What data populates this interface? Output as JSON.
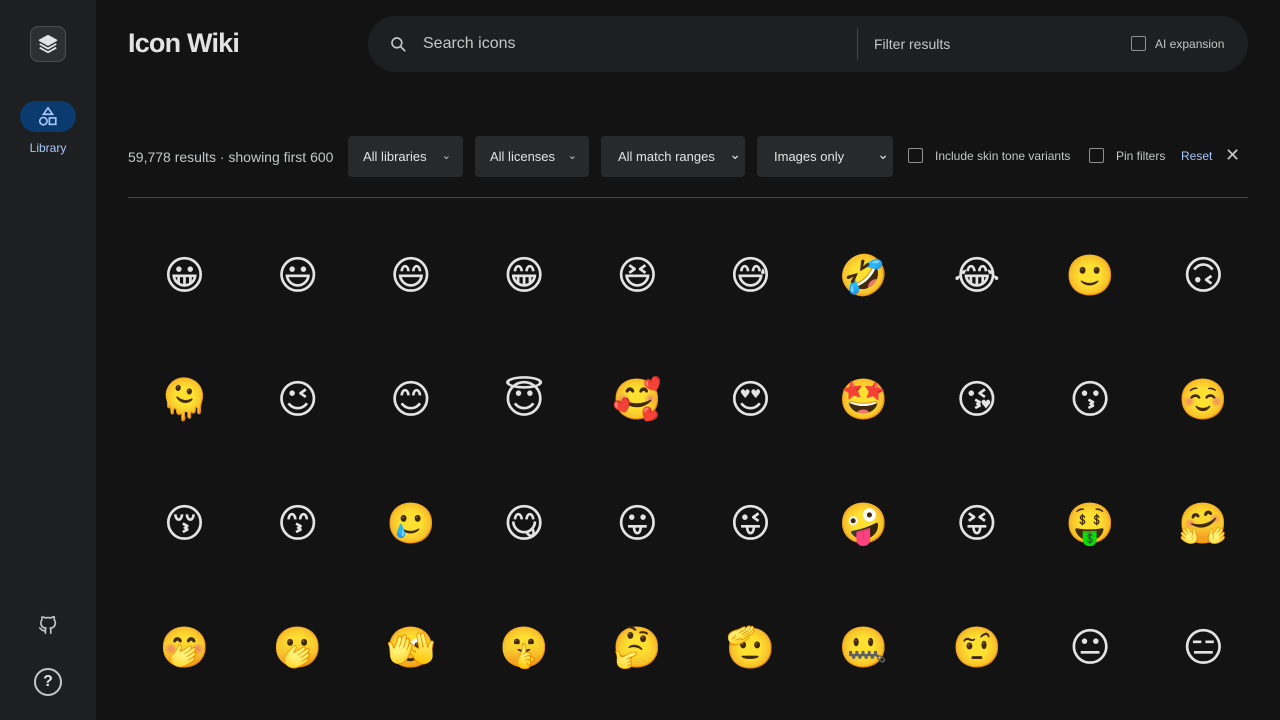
{
  "app": {
    "title": "Icon Wiki"
  },
  "rail": {
    "logo_icon": "layers-icon",
    "nav_items": [
      {
        "label": "Library",
        "icon": "shapes-icon",
        "active": true
      }
    ],
    "footer_icons": [
      "github-icon",
      "help-icon"
    ],
    "help_glyph": "?"
  },
  "search": {
    "placeholder": "Search icons",
    "value": "",
    "filter_placeholder": "Filter results",
    "filter_value": "",
    "ai_expansion_label": "AI expansion",
    "ai_expansion_checked": false
  },
  "filters": {
    "results_text": "59,778 results · showing first 600",
    "libraries": "All libraries",
    "licenses": "All licenses",
    "match_ranges": "All match ranges",
    "media": "Images only",
    "skin_tone_label": "Include skin tone variants",
    "skin_tone_checked": false,
    "pin_filters_label": "Pin filters",
    "pin_filters_checked": false,
    "reset_label": "Reset",
    "close_glyph": "✕"
  },
  "colors": {
    "background": "#131314",
    "rail": "#1e1f20",
    "accent": "#a8c7fa",
    "active_pill": "#0b3a6e"
  },
  "icons": [
    [
      "😀",
      "😃",
      "😄",
      "😁",
      "😆",
      "😅",
      "🤣",
      "😂",
      "🙂",
      "🙃"
    ],
    [
      "🫠",
      "😉",
      "😊",
      "😇",
      "🥰",
      "😍",
      "🤩",
      "😘",
      "😗",
      "☺️"
    ],
    [
      "😚",
      "😙",
      "🥲",
      "😋",
      "😛",
      "😜",
      "🤪",
      "😝",
      "🤑",
      "🤗"
    ],
    [
      "🤭",
      "🫢",
      "🫣",
      "🤫",
      "🤔",
      "🫡",
      "🤐",
      "🤨",
      "😐",
      "😑"
    ]
  ]
}
